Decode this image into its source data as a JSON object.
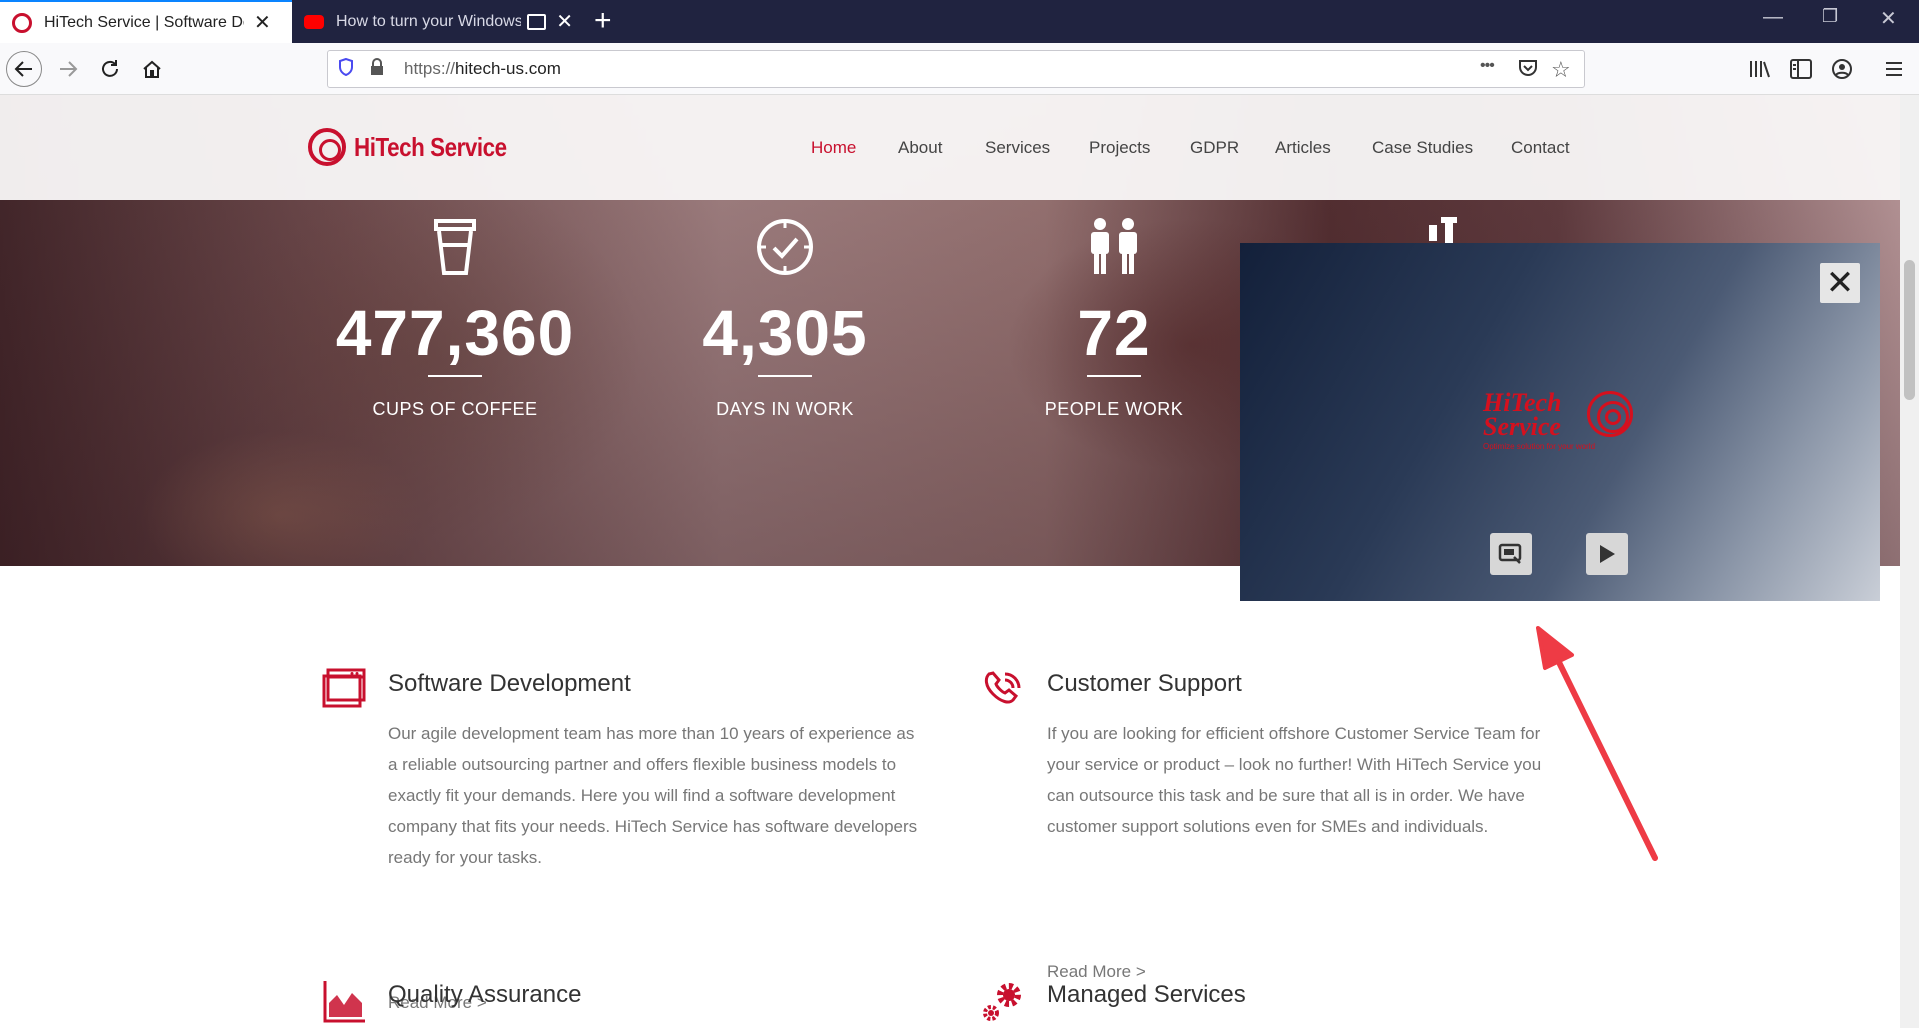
{
  "browser": {
    "tabs": [
      {
        "title": "HiTech Service | Software Development",
        "active": true
      },
      {
        "title": "How to turn your Windows",
        "active": false
      }
    ],
    "url_prefix": "https://",
    "url_domain": "hitech-us.com",
    "new_tab_label": "+",
    "more_label": "•••"
  },
  "site": {
    "logo_text": "HiTech Service",
    "menu": [
      "Home",
      "About",
      "Services",
      "Projects",
      "GDPR",
      "Articles",
      "Case Studies",
      "Contact"
    ],
    "active_menu": "Home"
  },
  "stats": [
    {
      "value": "477,360",
      "label": "CUPS OF COFFEE",
      "icon": "coffee-cup-icon"
    },
    {
      "value": "4,305",
      "label": "DAYS IN WORK",
      "icon": "clock-check-icon"
    },
    {
      "value": "72",
      "label": "PEOPLE WORK",
      "icon": "people-icon"
    }
  ],
  "services": [
    {
      "title": "Software Development",
      "icon": "browser-window-icon",
      "text": "Our agile development team has more than 10 years of experience as a reliable outsourcing partner and offers flexible business models to exactly fit your demands. Here you will find a software development company that fits your needs. HiTech Service has software developers ready for your tasks.",
      "more": "Read More >"
    },
    {
      "title": "Customer Support",
      "icon": "phone-call-icon",
      "text": "If you are looking for efficient offshore Customer Service Team for your service or product – look no further! With HiTech Service you can outsource this task and be sure that all is in order. We have customer support solutions even for SMEs and individuals.",
      "more": "Read More >"
    },
    {
      "title": "Quality Assurance",
      "icon": "chart-icon"
    },
    {
      "title": "Managed Services",
      "icon": "gears-icon"
    }
  ],
  "pip": {
    "logo_line1": "HiTech",
    "logo_line2": "Service",
    "tagline": "Optimize solution for your world",
    "close_label": "✕"
  },
  "colors": {
    "brand": "#c8102e",
    "tab_strip": "#202340",
    "annotation_arrow": "#ee3b45"
  }
}
